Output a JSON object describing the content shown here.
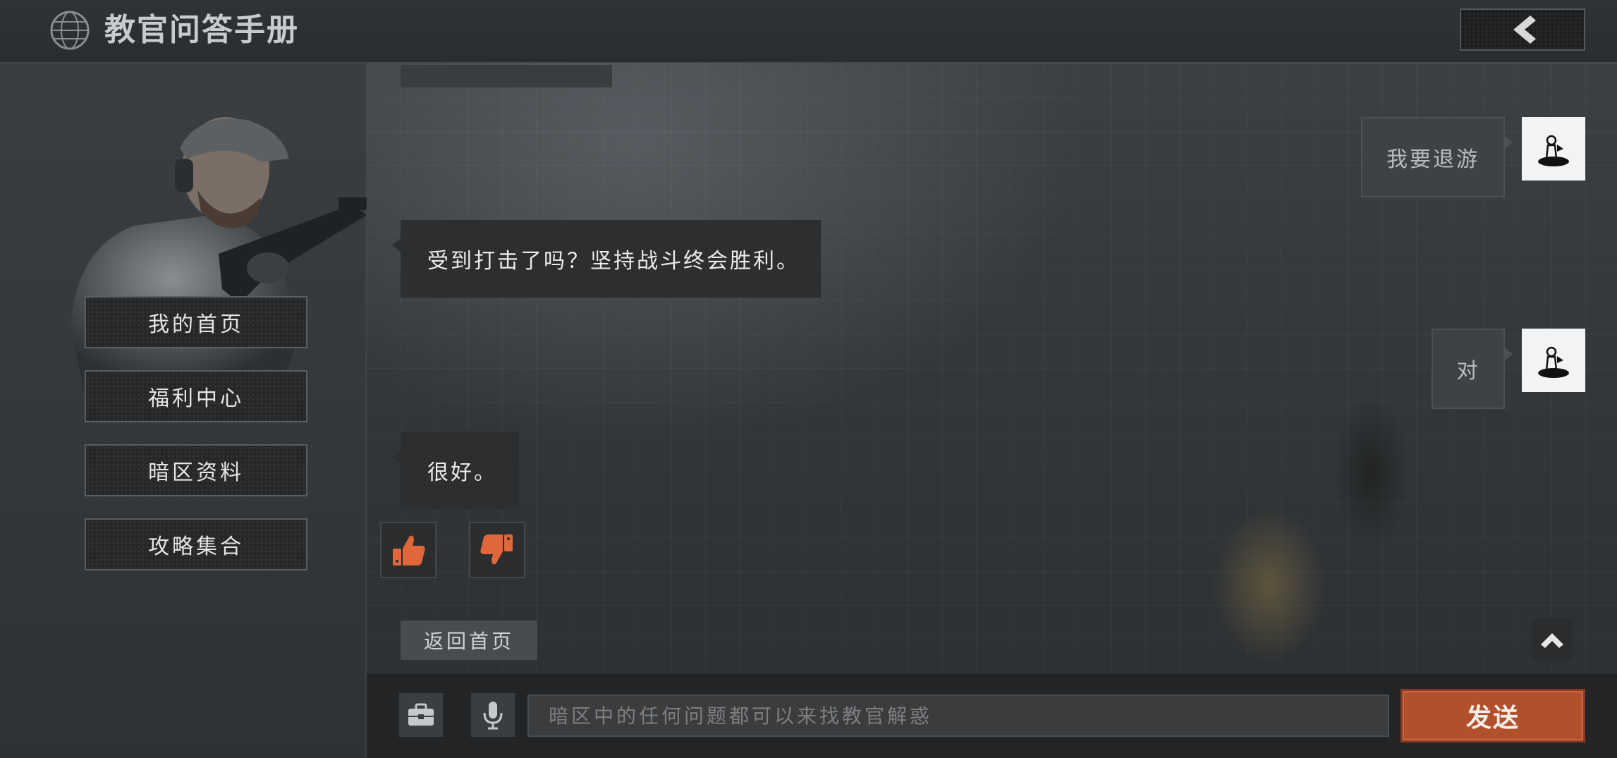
{
  "header": {
    "title": "教官问答手册",
    "logo_icon": "globe-icon",
    "back_icon": "chevron-left-icon"
  },
  "sidebar": {
    "items": [
      {
        "label": "我的首页"
      },
      {
        "label": "福利中心"
      },
      {
        "label": "暗区资料"
      },
      {
        "label": "攻略集合"
      }
    ]
  },
  "chat": {
    "messages": [
      {
        "from": "user",
        "text": "我要退游"
      },
      {
        "from": "instructor",
        "text": "受到打击了吗？坚持战斗终会胜利。"
      },
      {
        "from": "user",
        "text": "对"
      },
      {
        "from": "instructor",
        "text": "很好。"
      }
    ],
    "feedback": {
      "like_icon": "thumbs-up-icon",
      "dislike_icon": "thumbs-down-icon"
    },
    "return_label": "返回首页",
    "scroll_top_icon": "chevron-up-icon"
  },
  "input_bar": {
    "toolbox_icon": "toolbox-icon",
    "mic_icon": "microphone-icon",
    "placeholder": "暗区中的任何问题都可以来找教官解惑",
    "send_label": "发送"
  },
  "colors": {
    "accent": "#b3502c",
    "vote_icon": "#e0673a"
  }
}
